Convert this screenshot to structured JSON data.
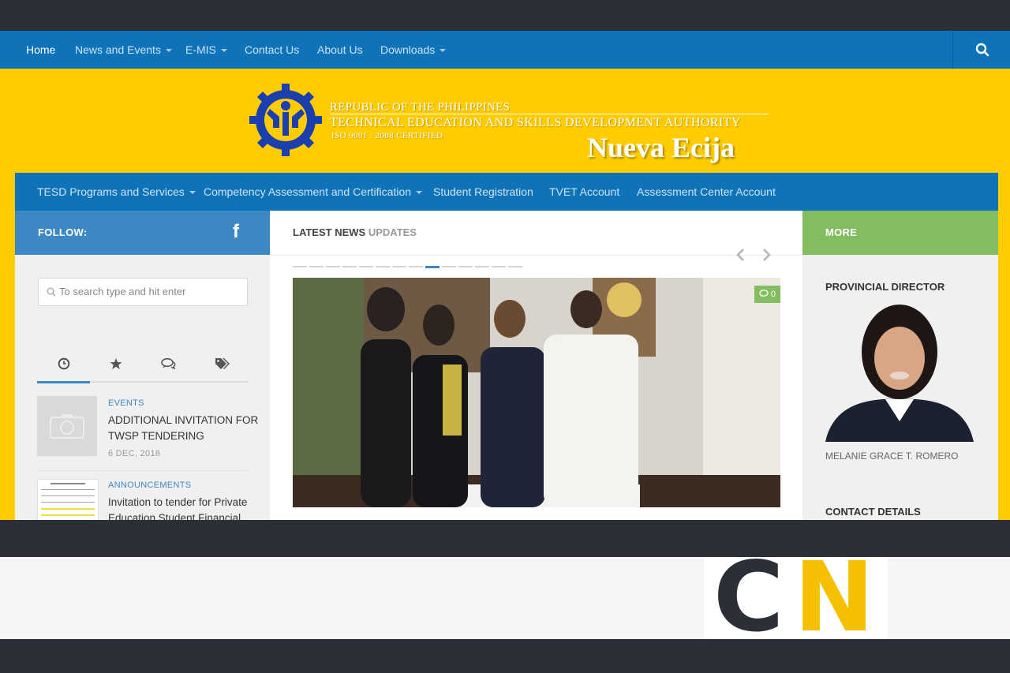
{
  "top_nav": {
    "items": [
      {
        "label": "Home"
      },
      {
        "label": "News and Events"
      },
      {
        "label": "E-MIS"
      },
      {
        "label": "Contact Us"
      },
      {
        "label": "About Us"
      },
      {
        "label": "Downloads"
      }
    ]
  },
  "header": {
    "line1": "REPUBLIC OF THE PHILIPPINES",
    "line2": "TECHNICAL EDUCATION AND SKILLS DEVELOPMENT AUTHORITY",
    "line3": "ISO 9001 : 2008 CERTIFIED",
    "region": "Nueva Ecija"
  },
  "sub_nav": {
    "items": [
      {
        "label": "TESD Programs and Services"
      },
      {
        "label": "Competency Assessment and Certification"
      },
      {
        "label": "Student Registration"
      },
      {
        "label": "TVET Account"
      },
      {
        "label": "Assessment Center Account"
      }
    ]
  },
  "sidebar": {
    "follow_label": "FOLLOW:",
    "search_placeholder": "To search type and hit enter",
    "posts": [
      {
        "category": "EVENTS",
        "title_line1": "ADDITIONAL INVITATION FOR",
        "title_line2": "TWSP TENDERING",
        "date": "6 DEC, 2016"
      },
      {
        "category": "ANNOUNCEMENTS",
        "title_line1": "Invitation to tender for Private",
        "title_line2": "Education Student Financial"
      }
    ]
  },
  "center": {
    "title_bold": "LATEST NEWS",
    "title_light": "UPDATES",
    "comment_count": "0"
  },
  "right": {
    "more_label": "MORE",
    "director_heading": "PROVINCIAL DIRECTOR",
    "director_name": "MELANIE GRACE T. ROMERO",
    "contact_heading": "CONTACT DETAILS"
  },
  "brand": {
    "letter1": "C",
    "letter2": "N"
  },
  "colors": {
    "nav_blue": "#0f73b9",
    "header_yellow": "#ffcc00",
    "follow_blue": "#3b88c4",
    "more_green": "#82bd5f",
    "dark": "#2a2f38",
    "category_blue": "#3b88c4"
  }
}
